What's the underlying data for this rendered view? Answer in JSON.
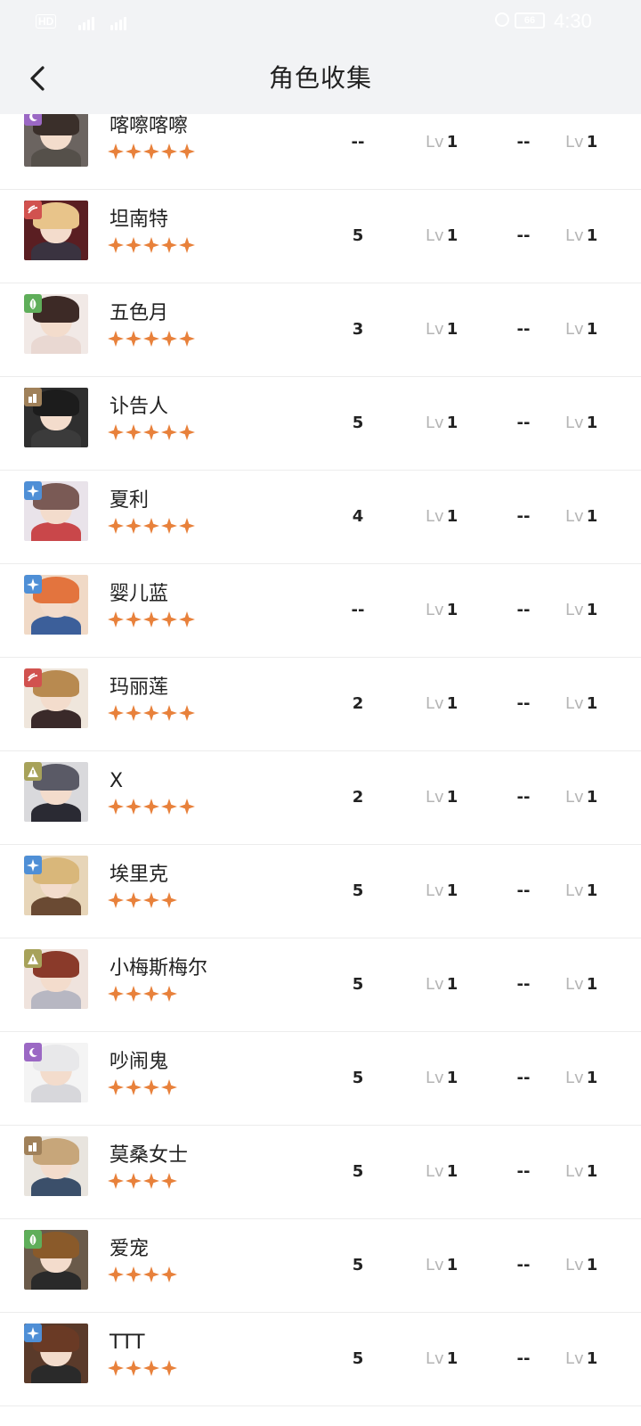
{
  "status_bar": {
    "time": "4:30",
    "hd_label": "HD",
    "battery_level": "66"
  },
  "header": {
    "title": "角色收集",
    "back_icon": "chevron-left-icon"
  },
  "colors": {
    "star": "#e8813b",
    "role_purple": "#9b68c4",
    "role_red": "#d1524f",
    "role_green": "#5fae5a",
    "role_brown": "#a0815a",
    "role_blue": "#4f8fd6",
    "role_olive": "#a7a25a"
  },
  "lv_label": "Lv",
  "characters": [
    {
      "name": "喀嚓喀嚓",
      "stars": 5,
      "value": "--",
      "lv1": "1",
      "value2": "--",
      "lv2": "1",
      "role": "purple",
      "role_icon": "moon-icon"
    },
    {
      "name": "坦南特",
      "stars": 5,
      "value": "5",
      "lv1": "1",
      "value2": "--",
      "lv2": "1",
      "role": "red",
      "role_icon": "wave-icon"
    },
    {
      "name": "五色月",
      "stars": 5,
      "value": "3",
      "lv1": "1",
      "value2": "--",
      "lv2": "1",
      "role": "green",
      "role_icon": "leaf-icon"
    },
    {
      "name": "讣告人",
      "stars": 5,
      "value": "5",
      "lv1": "1",
      "value2": "--",
      "lv2": "1",
      "role": "brown",
      "role_icon": "tower-icon"
    },
    {
      "name": "夏利",
      "stars": 5,
      "value": "4",
      "lv1": "1",
      "value2": "--",
      "lv2": "1",
      "role": "blue",
      "role_icon": "star-icon"
    },
    {
      "name": "婴儿蓝",
      "stars": 5,
      "value": "--",
      "lv1": "1",
      "value2": "--",
      "lv2": "1",
      "role": "blue",
      "role_icon": "star-icon"
    },
    {
      "name": "玛丽莲",
      "stars": 5,
      "value": "2",
      "lv1": "1",
      "value2": "--",
      "lv2": "1",
      "role": "red",
      "role_icon": "wave-icon"
    },
    {
      "name": "X",
      "stars": 5,
      "value": "2",
      "lv1": "1",
      "value2": "--",
      "lv2": "1",
      "role": "olive",
      "role_icon": "triangle-icon"
    },
    {
      "name": "埃里克",
      "stars": 4,
      "value": "5",
      "lv1": "1",
      "value2": "--",
      "lv2": "1",
      "role": "blue",
      "role_icon": "star-icon"
    },
    {
      "name": "小梅斯梅尔",
      "stars": 4,
      "value": "5",
      "lv1": "1",
      "value2": "--",
      "lv2": "1",
      "role": "olive",
      "role_icon": "triangle-icon"
    },
    {
      "name": "吵闹鬼",
      "stars": 4,
      "value": "5",
      "lv1": "1",
      "value2": "--",
      "lv2": "1",
      "role": "purple",
      "role_icon": "moon-icon"
    },
    {
      "name": "莫桑女士",
      "stars": 4,
      "value": "5",
      "lv1": "1",
      "value2": "--",
      "lv2": "1",
      "role": "brown",
      "role_icon": "tower-icon"
    },
    {
      "name": "爱宠",
      "stars": 4,
      "value": "5",
      "lv1": "1",
      "value2": "--",
      "lv2": "1",
      "role": "green",
      "role_icon": "leaf-icon"
    },
    {
      "name": "TTT",
      "stars": 4,
      "value": "5",
      "lv1": "1",
      "value2": "--",
      "lv2": "1",
      "role": "blue",
      "role_icon": "star-icon"
    }
  ]
}
